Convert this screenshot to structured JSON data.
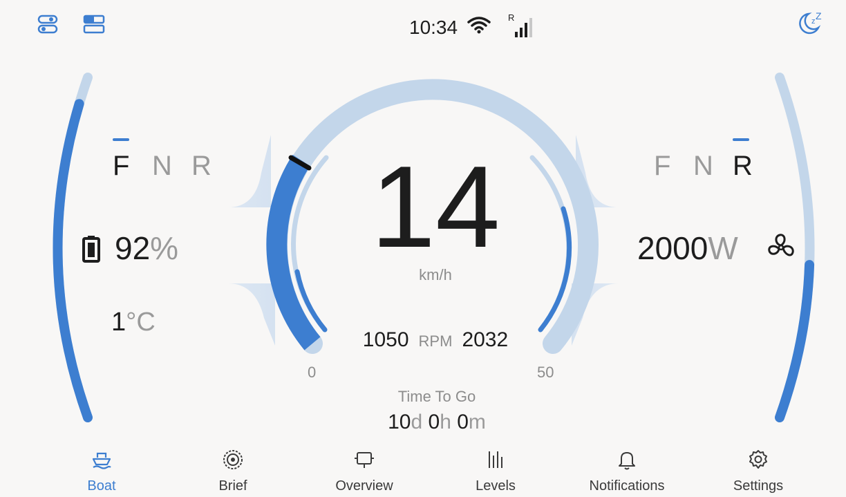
{
  "status_bar": {
    "time": "10:34",
    "signal_label": "R"
  },
  "left_panel": {
    "gears": [
      "F",
      "N",
      "R"
    ],
    "active_gear": "F",
    "battery_value": "92",
    "battery_unit": "%",
    "temperature_value": "1",
    "temperature_unit": "°C",
    "battery_level_fraction": 0.92
  },
  "right_panel": {
    "gears": [
      "F",
      "N",
      "R"
    ],
    "active_gear": "R",
    "power_value": "2000",
    "power_unit": "W",
    "power_level_fraction": 0.45
  },
  "speedometer": {
    "speed": "14",
    "speed_unit": "km/h",
    "rpm_left": "1050",
    "rpm_label": "RPM",
    "rpm_right": "2032",
    "scale_min": "0",
    "scale_max": "50",
    "speed_value": 14,
    "speed_max": 50
  },
  "time_to_go": {
    "label": "Time To Go",
    "days": "10",
    "days_unit": "d",
    "hours": "0",
    "hours_unit": "h",
    "minutes": "0",
    "minutes_unit": "m"
  },
  "nav": {
    "items": [
      {
        "label": "Boat",
        "icon": "boat-icon",
        "active": true
      },
      {
        "label": "Brief",
        "icon": "brief-icon",
        "active": false
      },
      {
        "label": "Overview",
        "icon": "overview-icon",
        "active": false
      },
      {
        "label": "Levels",
        "icon": "levels-icon",
        "active": false
      },
      {
        "label": "Notifications",
        "icon": "bell-icon",
        "active": false
      },
      {
        "label": "Settings",
        "icon": "gear-icon",
        "active": false
      }
    ]
  },
  "colors": {
    "accent": "#3d7ed0",
    "track": "#c3d6ea",
    "background": "#f8f7f6"
  }
}
